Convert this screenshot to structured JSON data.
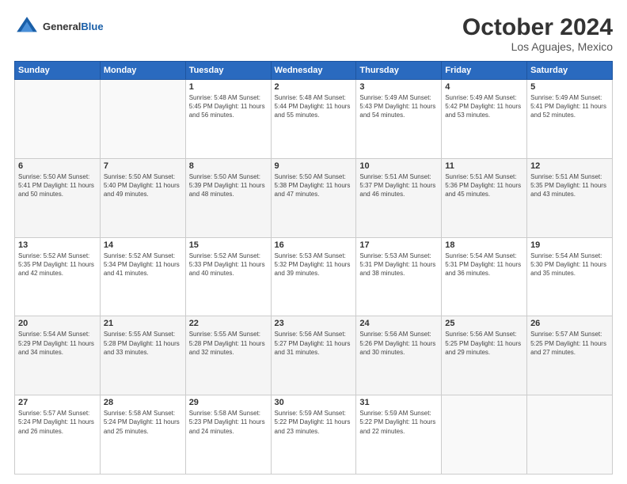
{
  "header": {
    "logo_general": "General",
    "logo_blue": "Blue",
    "month_title": "October 2024",
    "location": "Los Aguajes, Mexico"
  },
  "days_of_week": [
    "Sunday",
    "Monday",
    "Tuesday",
    "Wednesday",
    "Thursday",
    "Friday",
    "Saturday"
  ],
  "weeks": [
    [
      {
        "day": "",
        "info": ""
      },
      {
        "day": "",
        "info": ""
      },
      {
        "day": "1",
        "info": "Sunrise: 5:48 AM\nSunset: 5:45 PM\nDaylight: 11 hours and 56 minutes."
      },
      {
        "day": "2",
        "info": "Sunrise: 5:48 AM\nSunset: 5:44 PM\nDaylight: 11 hours and 55 minutes."
      },
      {
        "day": "3",
        "info": "Sunrise: 5:49 AM\nSunset: 5:43 PM\nDaylight: 11 hours and 54 minutes."
      },
      {
        "day": "4",
        "info": "Sunrise: 5:49 AM\nSunset: 5:42 PM\nDaylight: 11 hours and 53 minutes."
      },
      {
        "day": "5",
        "info": "Sunrise: 5:49 AM\nSunset: 5:41 PM\nDaylight: 11 hours and 52 minutes."
      }
    ],
    [
      {
        "day": "6",
        "info": "Sunrise: 5:50 AM\nSunset: 5:41 PM\nDaylight: 11 hours and 50 minutes."
      },
      {
        "day": "7",
        "info": "Sunrise: 5:50 AM\nSunset: 5:40 PM\nDaylight: 11 hours and 49 minutes."
      },
      {
        "day": "8",
        "info": "Sunrise: 5:50 AM\nSunset: 5:39 PM\nDaylight: 11 hours and 48 minutes."
      },
      {
        "day": "9",
        "info": "Sunrise: 5:50 AM\nSunset: 5:38 PM\nDaylight: 11 hours and 47 minutes."
      },
      {
        "day": "10",
        "info": "Sunrise: 5:51 AM\nSunset: 5:37 PM\nDaylight: 11 hours and 46 minutes."
      },
      {
        "day": "11",
        "info": "Sunrise: 5:51 AM\nSunset: 5:36 PM\nDaylight: 11 hours and 45 minutes."
      },
      {
        "day": "12",
        "info": "Sunrise: 5:51 AM\nSunset: 5:35 PM\nDaylight: 11 hours and 43 minutes."
      }
    ],
    [
      {
        "day": "13",
        "info": "Sunrise: 5:52 AM\nSunset: 5:35 PM\nDaylight: 11 hours and 42 minutes."
      },
      {
        "day": "14",
        "info": "Sunrise: 5:52 AM\nSunset: 5:34 PM\nDaylight: 11 hours and 41 minutes."
      },
      {
        "day": "15",
        "info": "Sunrise: 5:52 AM\nSunset: 5:33 PM\nDaylight: 11 hours and 40 minutes."
      },
      {
        "day": "16",
        "info": "Sunrise: 5:53 AM\nSunset: 5:32 PM\nDaylight: 11 hours and 39 minutes."
      },
      {
        "day": "17",
        "info": "Sunrise: 5:53 AM\nSunset: 5:31 PM\nDaylight: 11 hours and 38 minutes."
      },
      {
        "day": "18",
        "info": "Sunrise: 5:54 AM\nSunset: 5:31 PM\nDaylight: 11 hours and 36 minutes."
      },
      {
        "day": "19",
        "info": "Sunrise: 5:54 AM\nSunset: 5:30 PM\nDaylight: 11 hours and 35 minutes."
      }
    ],
    [
      {
        "day": "20",
        "info": "Sunrise: 5:54 AM\nSunset: 5:29 PM\nDaylight: 11 hours and 34 minutes."
      },
      {
        "day": "21",
        "info": "Sunrise: 5:55 AM\nSunset: 5:28 PM\nDaylight: 11 hours and 33 minutes."
      },
      {
        "day": "22",
        "info": "Sunrise: 5:55 AM\nSunset: 5:28 PM\nDaylight: 11 hours and 32 minutes."
      },
      {
        "day": "23",
        "info": "Sunrise: 5:56 AM\nSunset: 5:27 PM\nDaylight: 11 hours and 31 minutes."
      },
      {
        "day": "24",
        "info": "Sunrise: 5:56 AM\nSunset: 5:26 PM\nDaylight: 11 hours and 30 minutes."
      },
      {
        "day": "25",
        "info": "Sunrise: 5:56 AM\nSunset: 5:25 PM\nDaylight: 11 hours and 29 minutes."
      },
      {
        "day": "26",
        "info": "Sunrise: 5:57 AM\nSunset: 5:25 PM\nDaylight: 11 hours and 27 minutes."
      }
    ],
    [
      {
        "day": "27",
        "info": "Sunrise: 5:57 AM\nSunset: 5:24 PM\nDaylight: 11 hours and 26 minutes."
      },
      {
        "day": "28",
        "info": "Sunrise: 5:58 AM\nSunset: 5:24 PM\nDaylight: 11 hours and 25 minutes."
      },
      {
        "day": "29",
        "info": "Sunrise: 5:58 AM\nSunset: 5:23 PM\nDaylight: 11 hours and 24 minutes."
      },
      {
        "day": "30",
        "info": "Sunrise: 5:59 AM\nSunset: 5:22 PM\nDaylight: 11 hours and 23 minutes."
      },
      {
        "day": "31",
        "info": "Sunrise: 5:59 AM\nSunset: 5:22 PM\nDaylight: 11 hours and 22 minutes."
      },
      {
        "day": "",
        "info": ""
      },
      {
        "day": "",
        "info": ""
      }
    ]
  ]
}
